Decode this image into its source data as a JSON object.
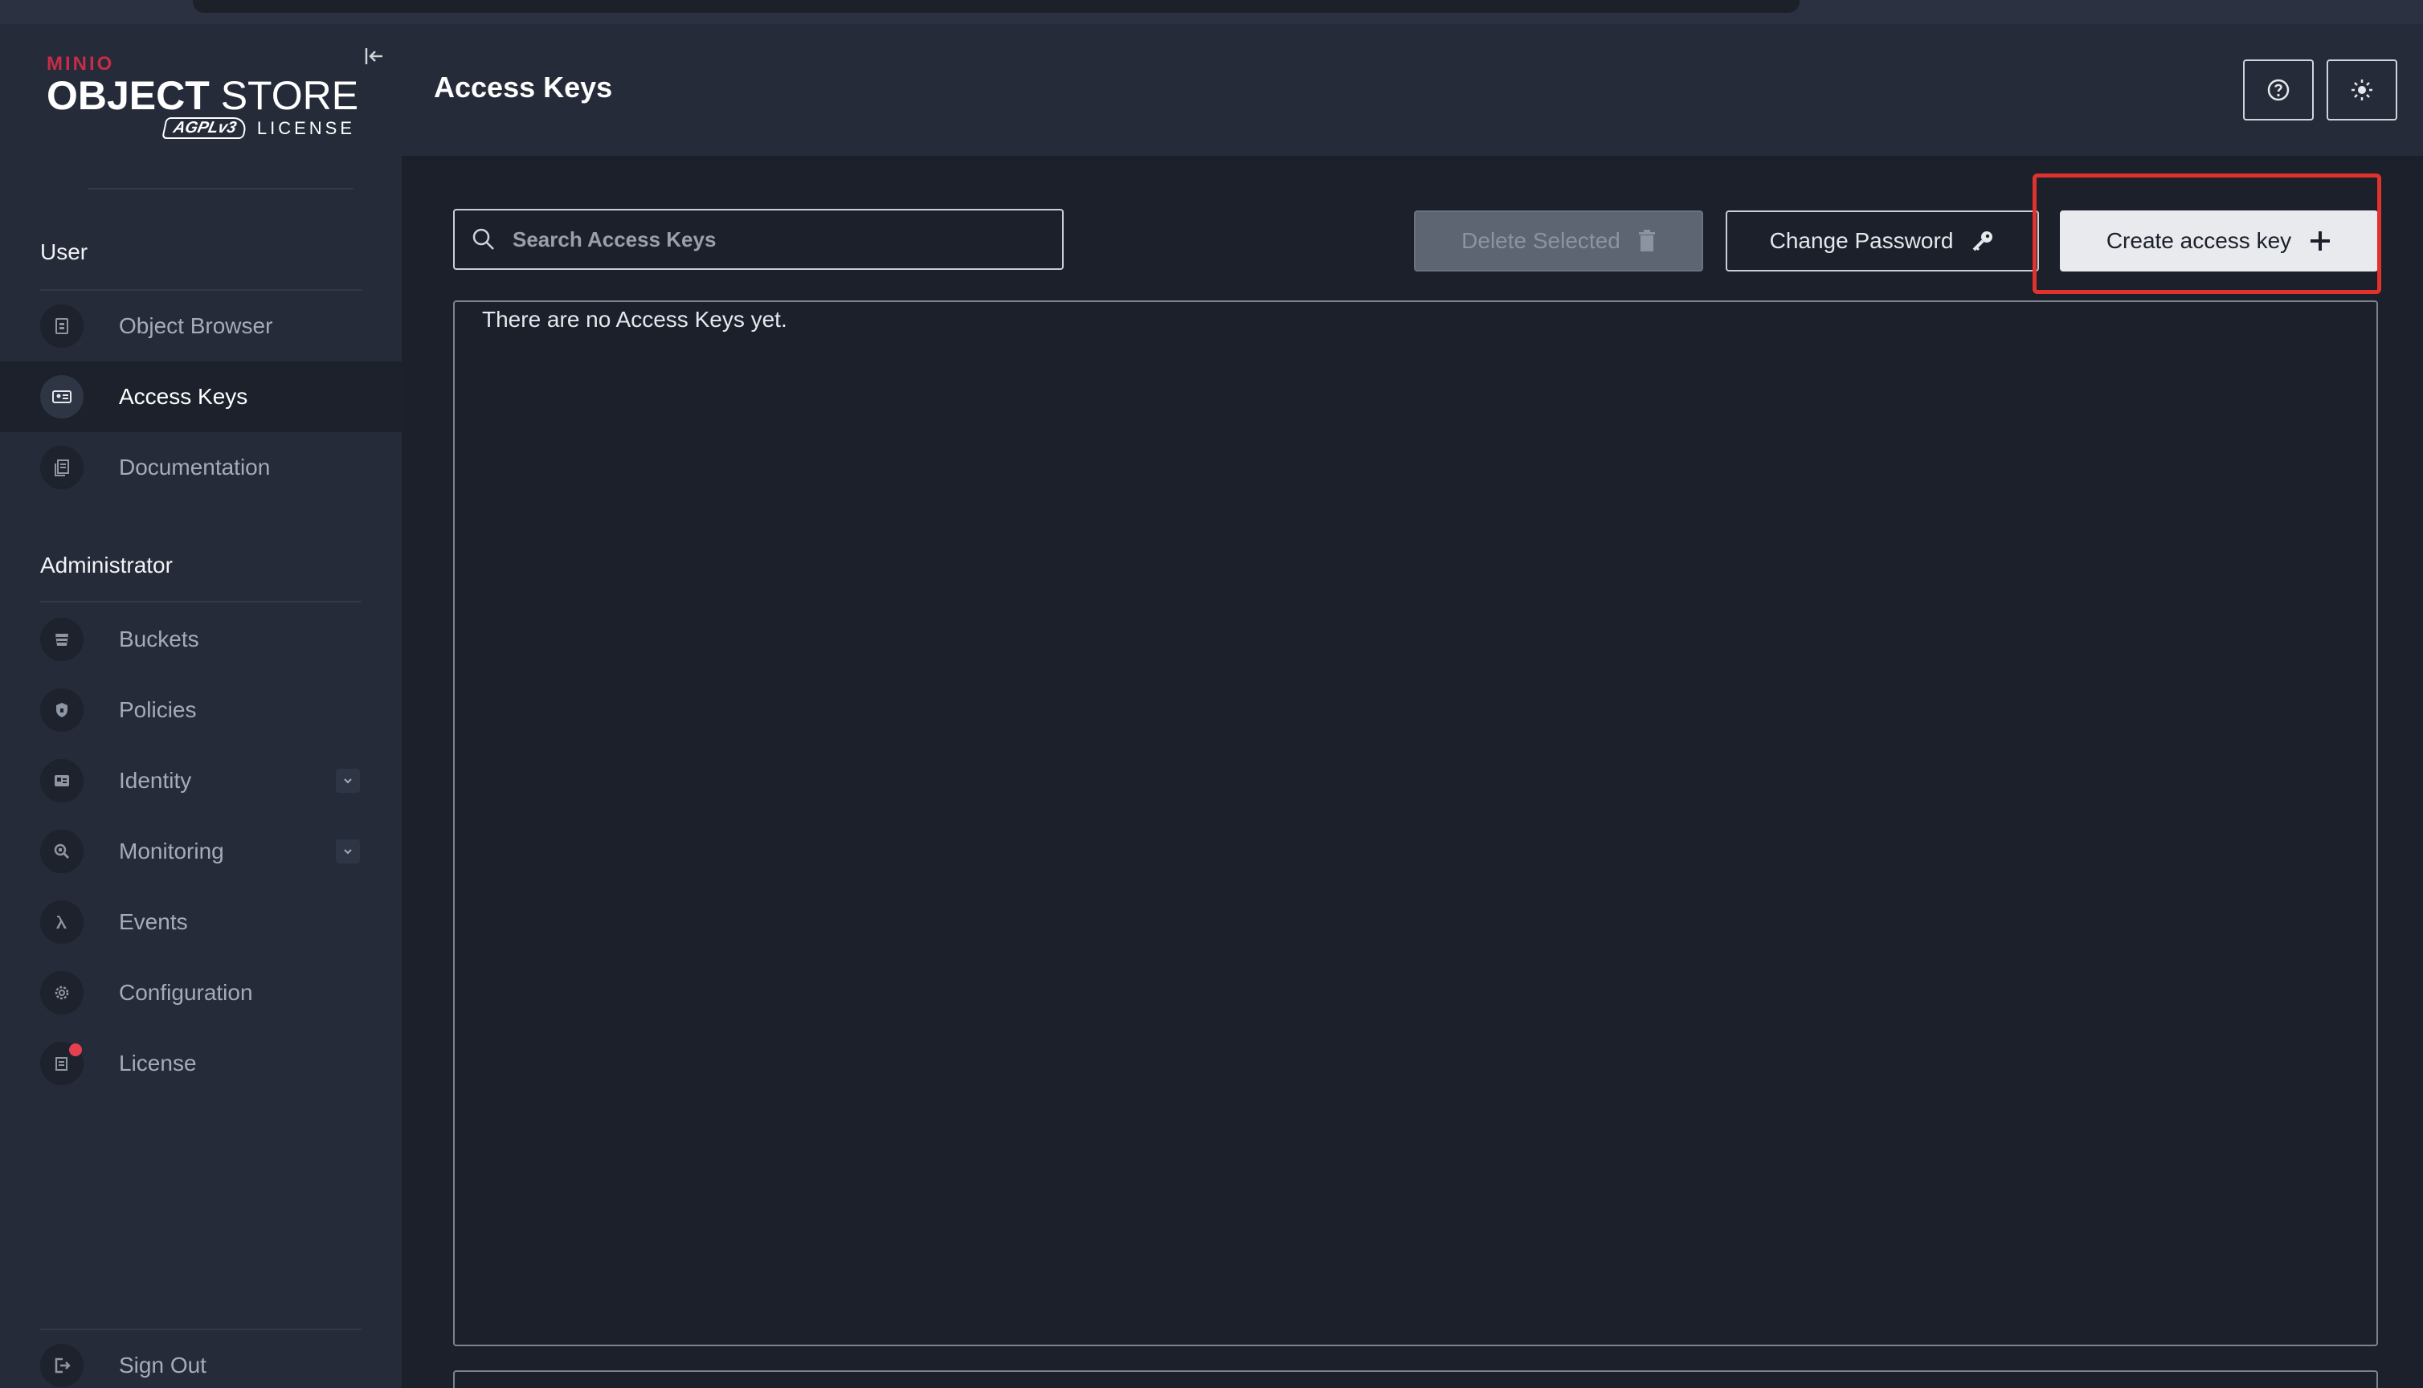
{
  "brand": {
    "maker": "MINIO",
    "product_bold": "OBJECT",
    "product_rest": " STORE",
    "badge": "AGPLv3",
    "license_word": "LICENSE"
  },
  "sidebar": {
    "sections": [
      {
        "title": "User",
        "items": [
          {
            "label": "Object Browser",
            "icon": "object-browser-icon",
            "active": false
          },
          {
            "label": "Access Keys",
            "icon": "access-keys-icon",
            "active": true
          },
          {
            "label": "Documentation",
            "icon": "documentation-icon",
            "active": false
          }
        ]
      },
      {
        "title": "Administrator",
        "items": [
          {
            "label": "Buckets",
            "icon": "bucket-icon"
          },
          {
            "label": "Policies",
            "icon": "policy-icon"
          },
          {
            "label": "Identity",
            "icon": "identity-icon",
            "expandable": true
          },
          {
            "label": "Monitoring",
            "icon": "monitoring-icon",
            "expandable": true
          },
          {
            "label": "Events",
            "icon": "lambda-icon"
          },
          {
            "label": "Configuration",
            "icon": "gear-icon"
          },
          {
            "label": "License",
            "icon": "license-icon",
            "notification": true
          }
        ]
      }
    ],
    "sign_out": "Sign Out"
  },
  "header": {
    "title": "Access Keys",
    "help_icon": "help-icon",
    "theme_icon": "sun-icon"
  },
  "toolbar": {
    "search_placeholder": "Search Access Keys",
    "delete_label": "Delete Selected",
    "change_password_label": "Change Password",
    "create_label": "Create access key"
  },
  "table": {
    "empty_message": "There are no Access Keys yet."
  },
  "colors": {
    "sidebar_bg": "#252b38",
    "main_bg": "#1b202b",
    "brand_red": "#c72c48",
    "highlight": "#e0332e"
  }
}
